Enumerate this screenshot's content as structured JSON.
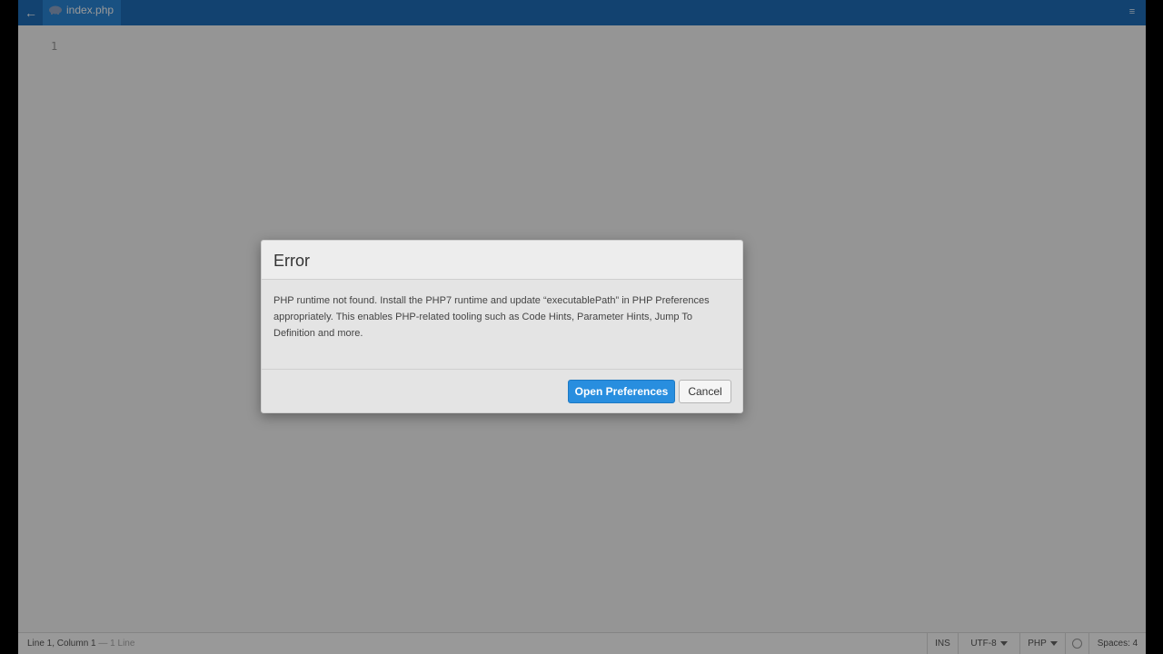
{
  "topbar": {
    "back_icon": "arrow-left-icon",
    "tab_label": "index.php",
    "tab_icon": "php-elephant-icon",
    "menu_icon": "hamburger-icon",
    "color": "#1e6fbb",
    "active_tab_color": "#2b87d9"
  },
  "editor": {
    "line_numbers": [
      "1"
    ]
  },
  "dialog": {
    "title": "Error",
    "message": "PHP runtime not found. Install the PHP7 runtime and update “executablePath” in PHP Preferences appropriately. This enables PHP-related tooling such as Code Hints, Parameter Hints, Jump To Definition and more.",
    "primary_button": "Open Preferences",
    "cancel_button": "Cancel",
    "primary_color": "#288edf"
  },
  "statusbar": {
    "cursor_position": "Line 1, Column 1",
    "separator": " — ",
    "line_count": "1 Line",
    "ins_mode": "INS",
    "encoding": "UTF-8",
    "language": "PHP",
    "lint_icon": "circle-icon",
    "indent": "Spaces: 4"
  }
}
